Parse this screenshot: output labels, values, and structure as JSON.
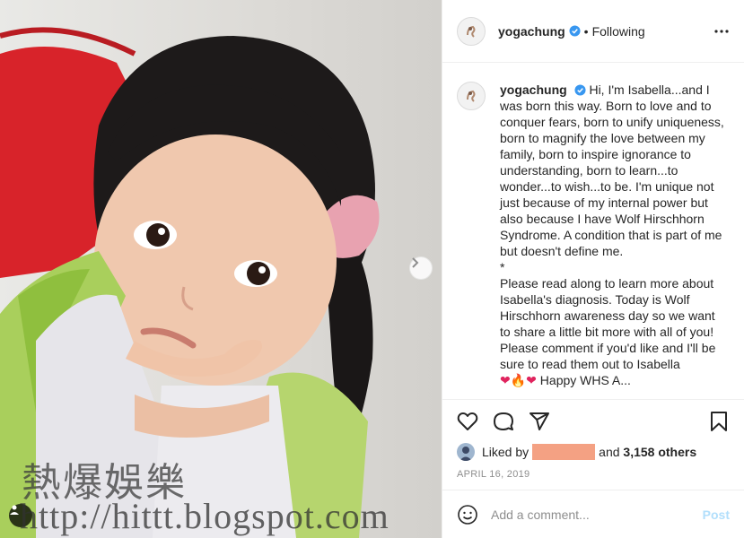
{
  "post": {
    "username": "yogachung",
    "follow_status": "Following",
    "separator": "•",
    "caption_lines": [
      "Hi, I'm Isabella...and I was born this way. Born to love and to conquer fears, born to unify uniqueness, born to magnify the love between my family, born to inspire ignorance to understanding, born to learn...to wonder...to wish...to be. I'm unique not just because of my internal power but also because I have Wolf Hirschhorn Syndrome. A condition that is part of me but doesn't define me.",
      "*",
      "Please read along to learn more about Isabella's diagnosis. Today is Wolf Hirschhorn awareness day so we want to share a little bit more with all of you! Please comment if you'd like and I'll be sure to read them out to Isabella"
    ],
    "emoji_line": "Happy WHS A..."
  },
  "likes": {
    "prefix": "Liked by",
    "connector": "and",
    "others": "3,158 others"
  },
  "date": "APRIL 16, 2019",
  "comment_box": {
    "placeholder": "Add a comment...",
    "post_label": "Post"
  },
  "watermark": {
    "chinese": "熱爆娛樂",
    "url": "http://hittt.blogspot.com"
  },
  "icons": {
    "more": "more-options-icon",
    "like": "heart-icon",
    "comment": "comment-icon",
    "share": "share-icon",
    "save": "bookmark-icon",
    "emoji": "emoji-icon",
    "next": "chevron-right-icon",
    "tag": "user-tag-icon"
  },
  "colors": {
    "verified": "#3897f0",
    "post_disabled": "#b2dffc",
    "redacted_name": "#f4a183"
  }
}
